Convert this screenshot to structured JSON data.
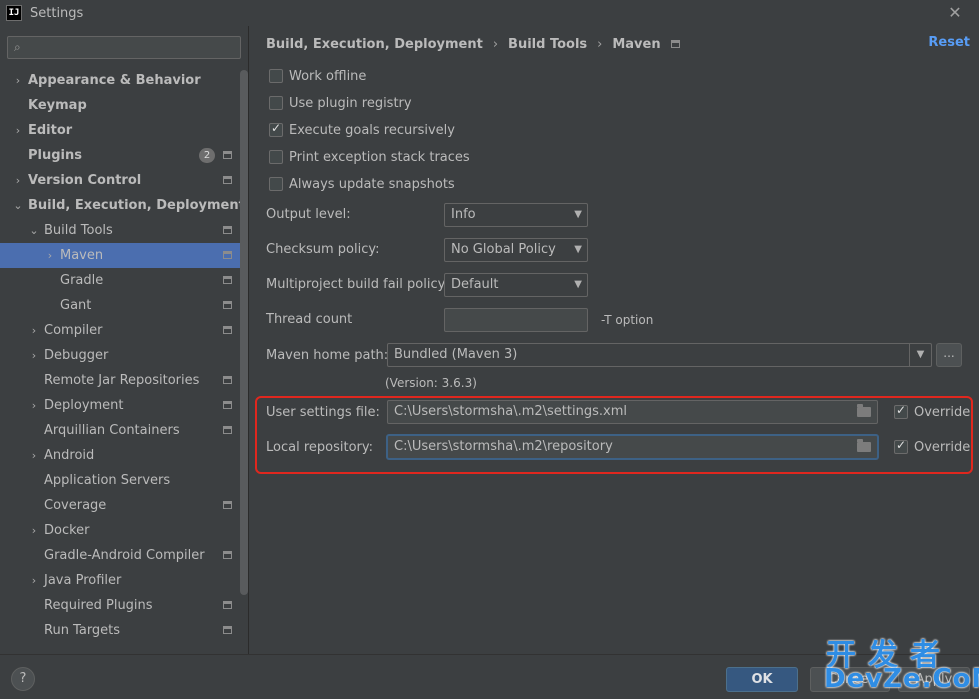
{
  "window": {
    "title": "Settings",
    "logo_text": "IJ",
    "close_glyph": "✕"
  },
  "search": {
    "placeholder": "",
    "icon_glyph": "⌕"
  },
  "sidebar": {
    "items": [
      {
        "label": "Appearance & Behavior",
        "chevron": "›",
        "bold": true,
        "depth": 0,
        "gear": false
      },
      {
        "label": "Keymap",
        "chevron": "",
        "bold": true,
        "depth": 0,
        "gear": false
      },
      {
        "label": "Editor",
        "chevron": "›",
        "bold": true,
        "depth": 0,
        "gear": false
      },
      {
        "label": "Plugins",
        "chevron": "",
        "bold": true,
        "depth": 0,
        "gear": true,
        "badge": "2"
      },
      {
        "label": "Version Control",
        "chevron": "›",
        "bold": true,
        "depth": 0,
        "gear": true
      },
      {
        "label": "Build, Execution, Deployment",
        "chevron": "⌄",
        "bold": true,
        "depth": 0,
        "gear": false
      },
      {
        "label": "Build Tools",
        "chevron": "⌄",
        "bold": false,
        "depth": 1,
        "gear": true
      },
      {
        "label": "Maven",
        "chevron": "›",
        "bold": false,
        "depth": 2,
        "gear": true,
        "selected": true
      },
      {
        "label": "Gradle",
        "chevron": "",
        "bold": false,
        "depth": 2,
        "gear": true
      },
      {
        "label": "Gant",
        "chevron": "",
        "bold": false,
        "depth": 2,
        "gear": true
      },
      {
        "label": "Compiler",
        "chevron": "›",
        "bold": false,
        "depth": 1,
        "gear": true
      },
      {
        "label": "Debugger",
        "chevron": "›",
        "bold": false,
        "depth": 1,
        "gear": false
      },
      {
        "label": "Remote Jar Repositories",
        "chevron": "",
        "bold": false,
        "depth": 1,
        "gear": true
      },
      {
        "label": "Deployment",
        "chevron": "›",
        "bold": false,
        "depth": 1,
        "gear": true
      },
      {
        "label": "Arquillian Containers",
        "chevron": "",
        "bold": false,
        "depth": 1,
        "gear": true
      },
      {
        "label": "Android",
        "chevron": "›",
        "bold": false,
        "depth": 1,
        "gear": false
      },
      {
        "label": "Application Servers",
        "chevron": "",
        "bold": false,
        "depth": 1,
        "gear": false
      },
      {
        "label": "Coverage",
        "chevron": "",
        "bold": false,
        "depth": 1,
        "gear": true
      },
      {
        "label": "Docker",
        "chevron": "›",
        "bold": false,
        "depth": 1,
        "gear": false
      },
      {
        "label": "Gradle-Android Compiler",
        "chevron": "",
        "bold": false,
        "depth": 1,
        "gear": true
      },
      {
        "label": "Java Profiler",
        "chevron": "›",
        "bold": false,
        "depth": 1,
        "gear": false
      },
      {
        "label": "Required Plugins",
        "chevron": "",
        "bold": false,
        "depth": 1,
        "gear": true
      },
      {
        "label": "Run Targets",
        "chevron": "",
        "bold": false,
        "depth": 1,
        "gear": true
      }
    ]
  },
  "breadcrumb": {
    "part1": "Build, Execution, Deployment",
    "part2": "Build Tools",
    "part3": "Maven",
    "separator": "›"
  },
  "reset_label": "Reset",
  "checkboxes": [
    {
      "label": "Work offline",
      "checked": false
    },
    {
      "label": "Use plugin registry",
      "checked": false
    },
    {
      "label": "Execute goals recursively",
      "checked": true
    },
    {
      "label": "Print exception stack traces",
      "checked": false
    },
    {
      "label": "Always update snapshots",
      "checked": false
    }
  ],
  "fields": {
    "output_level": {
      "label": "Output level:",
      "value": "Info"
    },
    "checksum_policy": {
      "label": "Checksum policy:",
      "value": "No Global Policy"
    },
    "multiproject_fail": {
      "label": "Multiproject build fail policy:",
      "value": "Default"
    },
    "thread_count": {
      "label": "Thread count",
      "value": "",
      "note": "-T option"
    },
    "maven_home": {
      "label": "Maven home path:",
      "value": "Bundled (Maven 3)",
      "version": "(Version: 3.6.3)",
      "browse": "..."
    },
    "user_settings": {
      "label": "User settings file:",
      "value": "C:\\Users\\stormsha\\.m2\\settings.xml",
      "override_label": "Override",
      "override": true
    },
    "local_repo": {
      "label": "Local repository:",
      "value": "C:\\Users\\stormsha\\.m2\\repository",
      "override_label": "Override",
      "override": true
    }
  },
  "footer": {
    "help": "?",
    "ok": "OK",
    "cancel": "Cancel",
    "apply": "Apply"
  },
  "watermark": {
    "top": "开发者",
    "bottom": "DevZe.CoM"
  },
  "colors": {
    "accent": "#4b6eaf",
    "highlight": "#e0271e",
    "link": "#589df6",
    "watermark": "#2f8de4"
  }
}
